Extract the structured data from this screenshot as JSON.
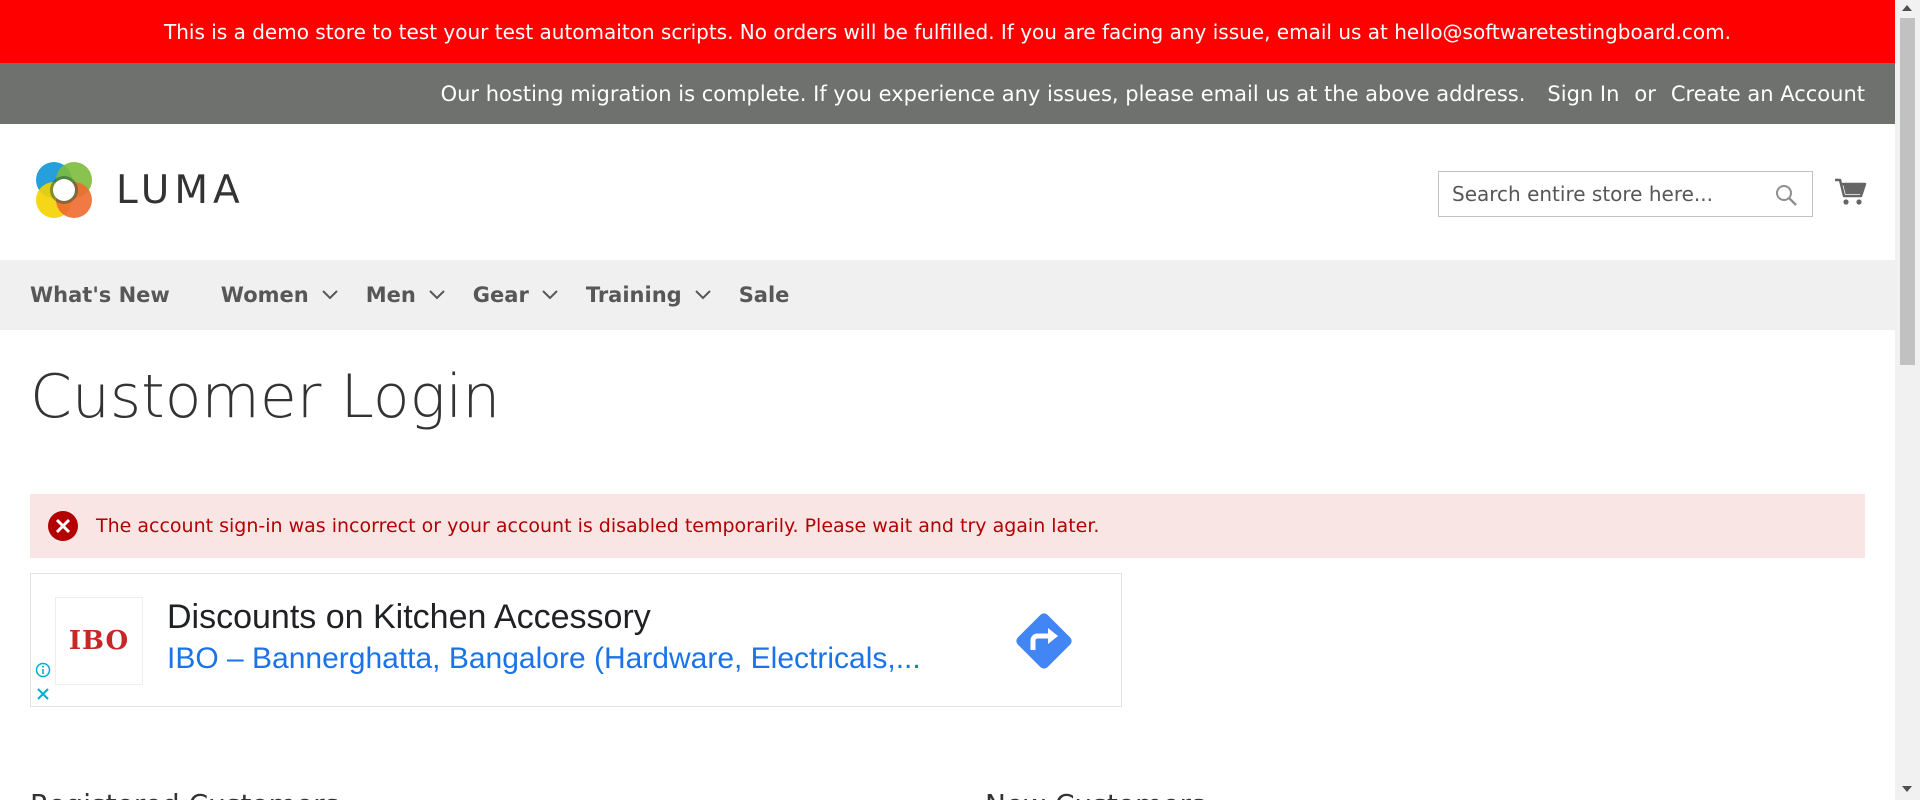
{
  "demo_notice": "This is a demo store to test your test automaiton scripts. No orders will be fulfilled. If you are facing any issue, email us at hello@softwaretestingboard.com.",
  "header": {
    "message": "Our hosting migration is complete. If you experience any issues, please email us at the above address.",
    "sign_in": "Sign In",
    "or": "or",
    "create_account": "Create an Account"
  },
  "logo": {
    "text": "LUMA"
  },
  "search": {
    "placeholder": "Search entire store here...",
    "value": ""
  },
  "nav": [
    {
      "label": "What's New",
      "has_dropdown": false
    },
    {
      "label": "Women",
      "has_dropdown": true
    },
    {
      "label": "Men",
      "has_dropdown": true
    },
    {
      "label": "Gear",
      "has_dropdown": true
    },
    {
      "label": "Training",
      "has_dropdown": true
    },
    {
      "label": "Sale",
      "has_dropdown": false
    }
  ],
  "page_title": "Customer Login",
  "error_message": "The account sign-in was incorrect or your account is disabled temporarily. Please wait and try again later.",
  "ad": {
    "logo_text": "IBO",
    "title": "Discounts on Kitchen Accessory",
    "subtitle": "IBO – Bannerghatta, Bangalore (Hardware, Electricals,..."
  },
  "sections": {
    "registered": "Registered Customers",
    "new": "New Customers"
  },
  "colors": {
    "notice_bg": "#ff0000",
    "panel_bg": "#6e716e",
    "nav_bg": "#f0f0f0",
    "error_bg": "#fae5e5",
    "error_text": "#b30000",
    "ad_link": "#1a73e8",
    "ad_arrow": "#4285f4"
  },
  "icons": {
    "search": "search-icon",
    "cart": "cart-icon",
    "error": "error-circle-icon",
    "chevron": "chevron-down-icon",
    "ad_arrow": "directions-arrow-icon",
    "ad_info": "info-icon",
    "ad_close": "close-icon"
  }
}
